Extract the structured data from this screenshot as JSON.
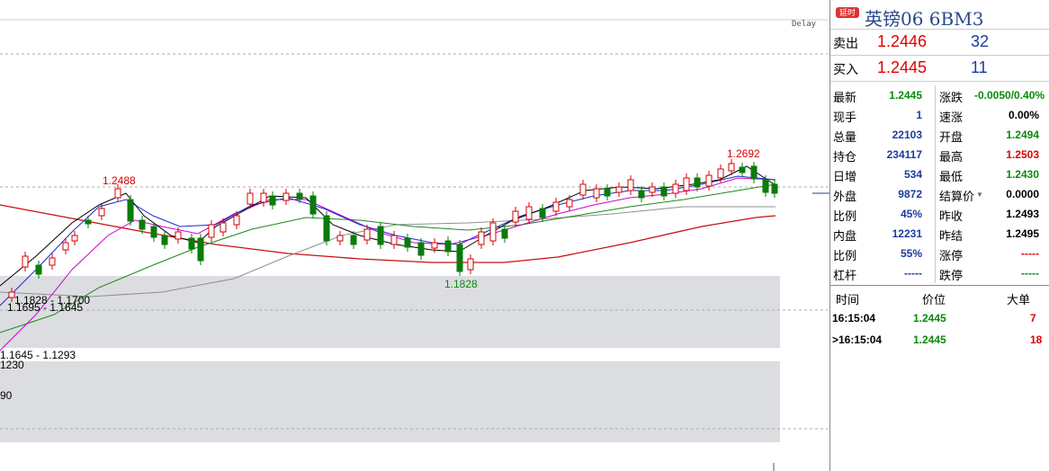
{
  "chart": {
    "delay_label": "Delay",
    "marker_high": "1.2692",
    "marker_left_high": "1.2488",
    "marker_low": "1.1828",
    "zone_labels": [
      "1.1828 - 1.1700",
      "1.1695 - 1.1645",
      "1.1645 - 1.1293",
      "1230",
      "90"
    ],
    "colors": {
      "up": "#d40000",
      "down": "#0a7a0a",
      "ma5": "#000000",
      "ma10": "#1a2ad0",
      "ma20": "#d000d0",
      "ma60": "#1a8a1a",
      "ma120": "#909090",
      "ma250": "#c81010",
      "zone": "#dcdde0"
    }
  },
  "panel": {
    "badge": "延时",
    "title": "英镑06  6BM3",
    "ask": {
      "label": "卖出",
      "price": "1.2446",
      "qty": "32"
    },
    "bid": {
      "label": "买入",
      "price": "1.2445",
      "qty": "11"
    },
    "stats": [
      {
        "l1": "最新",
        "v1": "1.2445",
        "c1": "green",
        "l2": "涨跌",
        "v2": "-0.0050/0.40%",
        "c2": "green"
      },
      {
        "l1": "现手",
        "v1": "1",
        "c1": "blue",
        "l2": "速涨",
        "v2": "0.00%",
        "c2": "black"
      },
      {
        "l1": "总量",
        "v1": "22103",
        "c1": "blue",
        "l2": "开盘",
        "v2": "1.2494",
        "c2": "green"
      },
      {
        "l1": "持仓",
        "v1": "234117",
        "c1": "blue",
        "l2": "最高",
        "v2": "1.2503",
        "c2": "red"
      },
      {
        "l1": "日增",
        "v1": "534",
        "c1": "blue",
        "l2": "最低",
        "v2": "1.2430",
        "c2": "green"
      },
      {
        "l1": "外盘",
        "v1": "9872",
        "c1": "blue",
        "l2": "结算价",
        "v2": "0.0000",
        "c2": "black"
      },
      {
        "l1": "比例",
        "v1": "45%",
        "c1": "blue",
        "l2": "昨收",
        "v2": "1.2493",
        "c2": "black"
      },
      {
        "l1": "内盘",
        "v1": "12231",
        "c1": "blue",
        "l2": "昨结",
        "v2": "1.2495",
        "c2": "black"
      },
      {
        "l1": "比例",
        "v1": "55%",
        "c1": "blue",
        "l2": "涨停",
        "v2": "-----",
        "c2": "red"
      },
      {
        "l1": "杠杆",
        "v1": "-----",
        "c1": "blue",
        "l2": "跌停",
        "v2": "-----",
        "c2": "green"
      }
    ],
    "ticks_header": {
      "time": "时间",
      "price": "价位",
      "size": "大单"
    },
    "ticks": [
      {
        "time": "16:15:04",
        "price": "1.2445",
        "size": "7"
      },
      {
        "time": ">16:15:04",
        "price": "1.2445",
        "size": "18"
      }
    ]
  }
}
